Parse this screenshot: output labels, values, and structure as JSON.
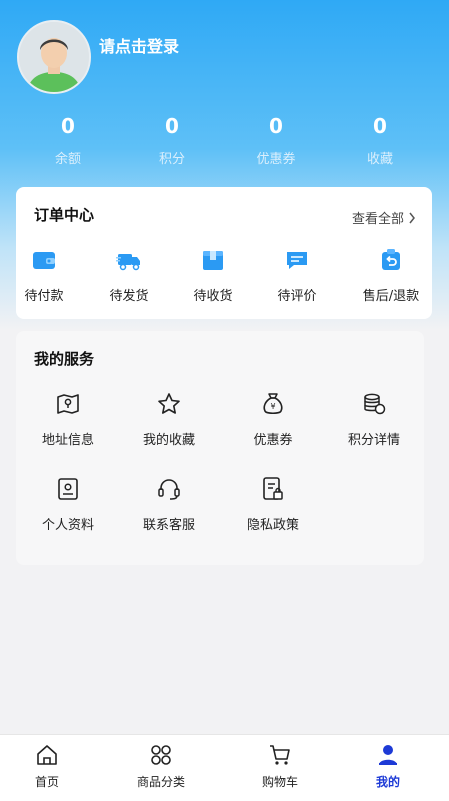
{
  "user": {
    "login_prompt": "请点击登录"
  },
  "stats": [
    {
      "value": "0",
      "label": "余额"
    },
    {
      "value": "0",
      "label": "积分"
    },
    {
      "value": "0",
      "label": "优惠券"
    },
    {
      "value": "0",
      "label": "收藏"
    }
  ],
  "orders": {
    "title": "订单中心",
    "view_all": "查看全部",
    "items": [
      {
        "label": "待付款",
        "icon": "wallet-icon"
      },
      {
        "label": "待发货",
        "icon": "truck-icon"
      },
      {
        "label": "待收货",
        "icon": "box-icon"
      },
      {
        "label": "待评价",
        "icon": "comment-icon"
      },
      {
        "label": "售后/退款",
        "icon": "refund-icon"
      }
    ]
  },
  "services": {
    "title": "我的服务",
    "items": [
      {
        "label": "地址信息",
        "icon": "map-icon"
      },
      {
        "label": "我的收藏",
        "icon": "star-icon"
      },
      {
        "label": "优惠券",
        "icon": "money-bag-icon"
      },
      {
        "label": "积分详情",
        "icon": "coins-icon"
      },
      {
        "label": "个人资料",
        "icon": "profile-card-icon"
      },
      {
        "label": "联系客服",
        "icon": "headset-icon"
      },
      {
        "label": "隐私政策",
        "icon": "privacy-doc-icon"
      }
    ]
  },
  "tabbar": [
    {
      "label": "首页",
      "icon": "home-icon"
    },
    {
      "label": "商品分类",
      "icon": "category-icon"
    },
    {
      "label": "购物车",
      "icon": "cart-icon"
    },
    {
      "label": "我的",
      "icon": "user-icon",
      "active": true
    }
  ],
  "colors": {
    "accent": "#2fa9f5",
    "active_tab": "#1d3ad6"
  }
}
